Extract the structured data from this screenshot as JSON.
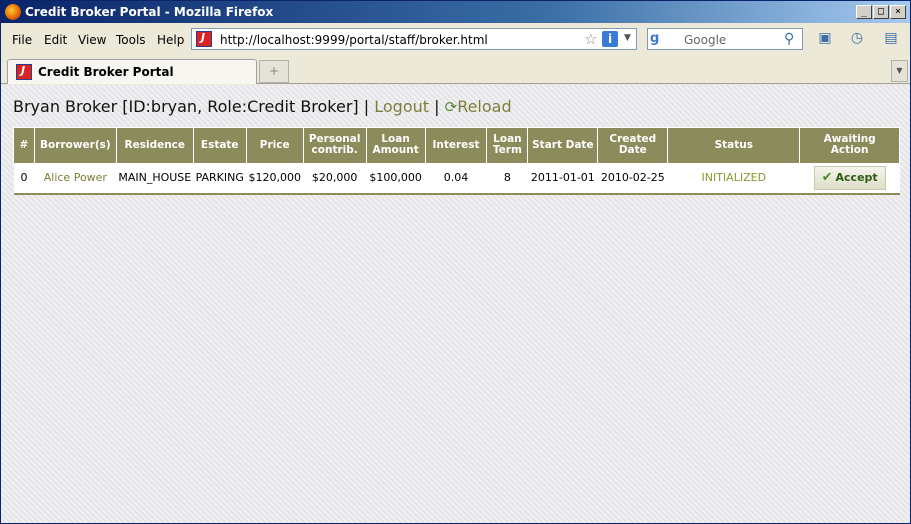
{
  "window": {
    "title": "Credit Broker Portal - Mozilla Firefox"
  },
  "menubar": {
    "items": [
      "File",
      "Edit",
      "View",
      "Tools",
      "Help"
    ]
  },
  "urlbar": {
    "url": "http://localhost:9999/portal/staff/broker.html"
  },
  "searchbar": {
    "placeholder": "Google"
  },
  "tabs": [
    {
      "label": "Credit Broker Portal"
    }
  ],
  "page": {
    "user_info": "Bryan Broker [ID:bryan, Role:Credit Broker]",
    "separator": "|",
    "logout_label": "Logout",
    "reload_label": "Reload"
  },
  "table": {
    "headers": [
      "#",
      "Borrower(s)",
      "Residence",
      "Estate",
      "Price",
      "Personal contrib.",
      "Loan Amount",
      "Interest",
      "Loan Term",
      "Start Date",
      "Created Date",
      "Status",
      "Awaiting Action"
    ],
    "rows": [
      {
        "index": "0",
        "borrower": "Alice Power",
        "residence": "MAIN_HOUSE",
        "estate": "PARKING",
        "price": "$120,000",
        "personal_contrib": "$20,000",
        "loan_amount": "$100,000",
        "interest": "0.04",
        "loan_term": "8",
        "start_date": "2011-01-01",
        "created_date": "2010-02-25",
        "status": "INITIALIZED",
        "action_label": "Accept"
      }
    ]
  },
  "colors": {
    "accent": "#8b8b5b",
    "link": "#7e7e3a",
    "status": "#8a9a2a"
  }
}
